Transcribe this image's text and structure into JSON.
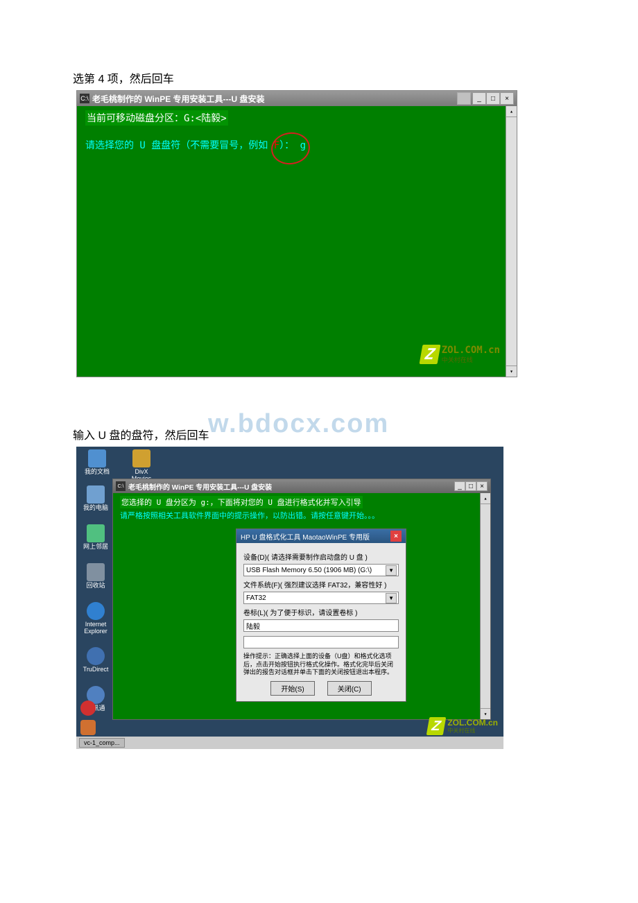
{
  "caption1": "选第 4 项，然后回车",
  "window1": {
    "title_icon": "C:\\",
    "title": "老毛桃制作的 WinPE 专用安装工具---U 盘安装",
    "line1": "当前可移动磁盘分区：G:<陆毅>",
    "line2_pre": "请选择您的 U 盘盘符（不需要冒号，例如 ",
    "line2_f": "F",
    "line2_post": "）：",
    "input_val": "g"
  },
  "zol": {
    "brand": "ZOL.COM.cn",
    "sub": "中关村在线"
  },
  "caption2": "输入 U 盘的盘符，然后回车",
  "watermark": "w.bdocx.com",
  "desktop": {
    "icons_top": [
      "我的文档",
      "DivX Movies"
    ],
    "icons_left": [
      "我的电脑",
      "网上邻居",
      "回收站",
      "Internet Explorer",
      "TruDirect",
      "腾讯通"
    ],
    "task": "vc-1_comp..."
  },
  "window2": {
    "title": "老毛桃制作的 WinPE 专用安装工具---U 盘安装",
    "line1": "您选择的 U 盘分区为 g:，下面将对您的 U 盘进行格式化并写入引导",
    "line2": "请严格按照相关工具软件界面中的提示操作，以防出错。请按任意键开始。。。"
  },
  "dialog": {
    "title": "HP U 盘格式化工具 MaotaoWinPE 专用版",
    "label_device": "设备(D)( 请选择需要制作启动盘的 U 盘 )",
    "device_value": "USB Flash Memory 6.50 (1906 MB) (G:\\)",
    "label_fs": "文件系统(F)( 强烈建议选择 FAT32，兼容性好 )",
    "fs_value": "FAT32",
    "label_vol": "卷标(L)( 为了便于标识，请设置卷标 )",
    "vol_value": "陆毅",
    "tip": "操作提示：正确选择上面的设备（U盘）和格式化选项后，点击开始按钮执行格式化操作。格式化完毕后关闭弹出的报告对话框并单击下面的关闭按钮退出本程序。",
    "btn_start": "开始(S)",
    "btn_close": "关闭(C)"
  }
}
